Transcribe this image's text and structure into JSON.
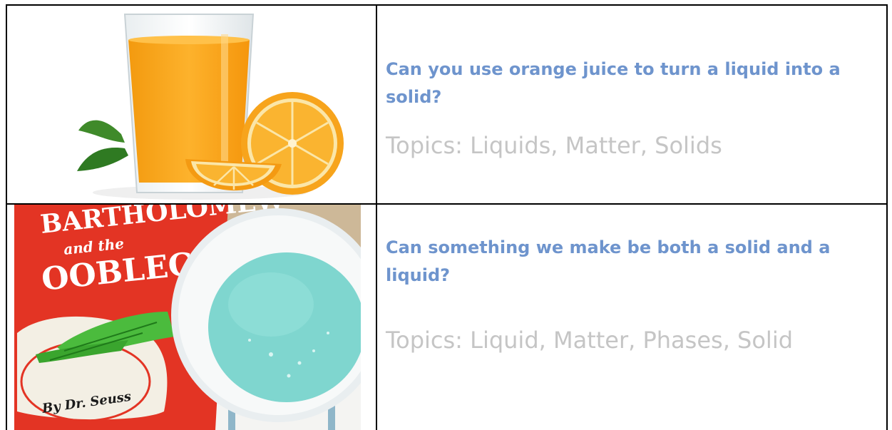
{
  "rows": [
    {
      "question": "Can you use orange juice to turn a liquid into a solid?",
      "topics": "Topics: Liquids, Matter, Solids",
      "image_icon": "orange-juice-glass-image"
    },
    {
      "question": "Can something we make be both a solid and a liquid?",
      "topics": "Topics: Liquid, Matter, Phases, Solid",
      "image_icon": "oobleck-bowl-book-image",
      "book_title_line1": "BARTHOLOMEW",
      "book_title_line2": "and the",
      "book_title_line3": "OOBLECK",
      "book_author": "By Dr. Seuss"
    }
  ],
  "colors": {
    "question_text": "#6e94cd",
    "topics_text": "#c5c5c5",
    "border": "#000000",
    "juice": "#f7a21b",
    "oobleck": "#7fd6cf",
    "book_red": "#e33424"
  }
}
